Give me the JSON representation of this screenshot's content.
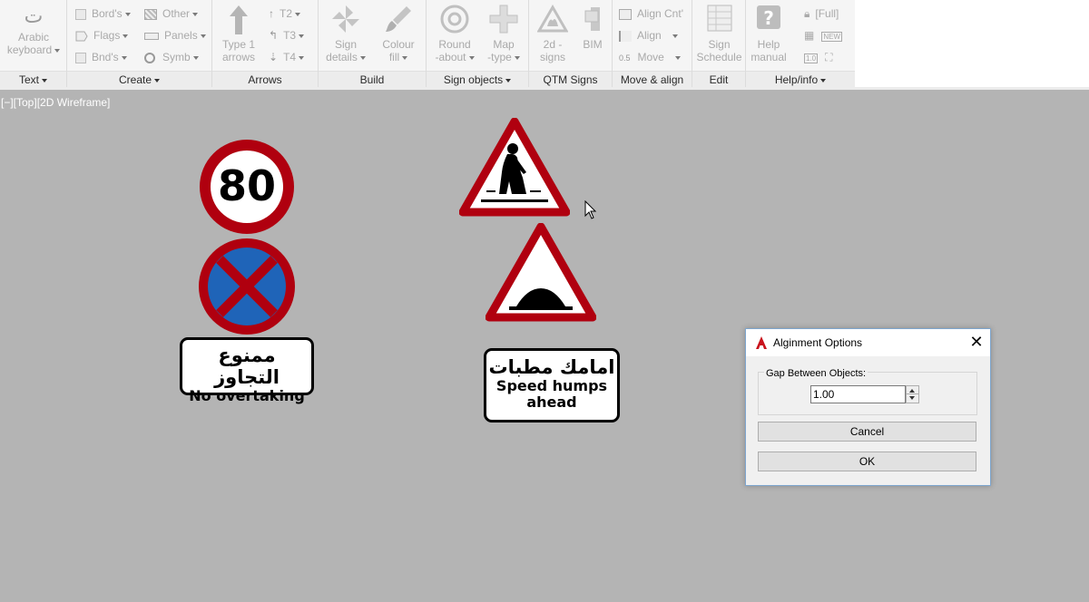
{
  "ribbon": {
    "panels": {
      "text": {
        "title": "Text",
        "arabic_keyboard": [
          "Arabic",
          "keyboard"
        ],
        "arabic_glyph": "ت"
      },
      "create": {
        "title": "Create",
        "bords": "Bord's",
        "flags": "Flags",
        "bnds": "Bnd's",
        "other": "Other",
        "panels": "Panels",
        "symb": "Symb"
      },
      "arrows": {
        "title": "Arrows",
        "type1": [
          "Type 1",
          "arrows"
        ],
        "t2": "T2",
        "t3": "T3",
        "t4": "T4"
      },
      "build": {
        "title": "Build",
        "sign_details": [
          "Sign",
          "details"
        ],
        "colour_fill": [
          "Colour",
          "fill"
        ]
      },
      "sign_objects": {
        "title": "Sign objects",
        "roundabout": [
          "Round",
          "-about"
        ],
        "map_type": [
          "Map",
          "-type"
        ]
      },
      "qtm": {
        "title": "QTM Signs",
        "signs_2d": [
          "2d -",
          "signs"
        ],
        "bim": "BIM"
      },
      "move_align": {
        "title": "Move & align",
        "align_cnt": "Align Cnt'",
        "align": "Align",
        "move": "Move",
        "move_prefix": "0.5"
      },
      "edit": {
        "title": "Edit",
        "sign_schedule": [
          "Sign",
          "Schedule"
        ]
      },
      "help": {
        "title": "Help/info",
        "help_manual": [
          "Help",
          "manual"
        ],
        "full": "[Full]",
        "new_label": "NEW",
        "one_zero": "1.0"
      }
    }
  },
  "viewport": {
    "label": "[−][Top][2D Wireframe]"
  },
  "signs": {
    "speed_limit": "80",
    "no_overtaking_ar": "ممنوع التجاوز",
    "no_overtaking_en": "No overtaking",
    "speed_humps_ar": "امامك مطبات",
    "speed_humps_en_1": "Speed humps",
    "speed_humps_en_2": "ahead"
  },
  "dialog": {
    "title": "Alginment Options",
    "gap_label": "Gap Between Objects:",
    "gap_value": "1.00",
    "cancel_label": "Cancel",
    "ok_label": "OK",
    "close_glyph": "✕",
    "app_icon_letter": "A"
  },
  "colors": {
    "sign_red": "#b0000f",
    "sign_blue": "#1f64b8",
    "viewport_bg": "#b4b4b4"
  }
}
